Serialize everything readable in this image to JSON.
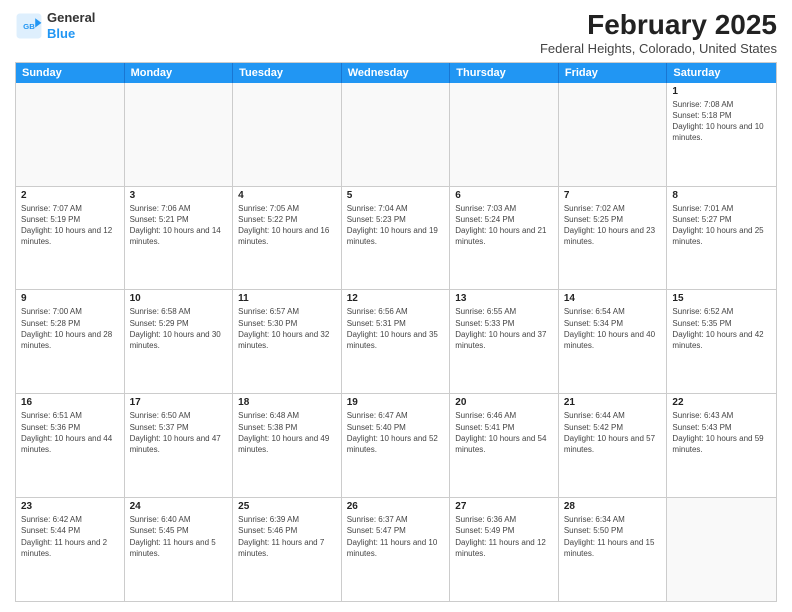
{
  "logo": {
    "text_general": "General",
    "text_blue": "Blue"
  },
  "header": {
    "title": "February 2025",
    "subtitle": "Federal Heights, Colorado, United States"
  },
  "calendar": {
    "days_of_week": [
      "Sunday",
      "Monday",
      "Tuesday",
      "Wednesday",
      "Thursday",
      "Friday",
      "Saturday"
    ],
    "weeks": [
      [
        {
          "day": "",
          "info": ""
        },
        {
          "day": "",
          "info": ""
        },
        {
          "day": "",
          "info": ""
        },
        {
          "day": "",
          "info": ""
        },
        {
          "day": "",
          "info": ""
        },
        {
          "day": "",
          "info": ""
        },
        {
          "day": "1",
          "info": "Sunrise: 7:08 AM\nSunset: 5:18 PM\nDaylight: 10 hours and 10 minutes."
        }
      ],
      [
        {
          "day": "2",
          "info": "Sunrise: 7:07 AM\nSunset: 5:19 PM\nDaylight: 10 hours and 12 minutes."
        },
        {
          "day": "3",
          "info": "Sunrise: 7:06 AM\nSunset: 5:21 PM\nDaylight: 10 hours and 14 minutes."
        },
        {
          "day": "4",
          "info": "Sunrise: 7:05 AM\nSunset: 5:22 PM\nDaylight: 10 hours and 16 minutes."
        },
        {
          "day": "5",
          "info": "Sunrise: 7:04 AM\nSunset: 5:23 PM\nDaylight: 10 hours and 19 minutes."
        },
        {
          "day": "6",
          "info": "Sunrise: 7:03 AM\nSunset: 5:24 PM\nDaylight: 10 hours and 21 minutes."
        },
        {
          "day": "7",
          "info": "Sunrise: 7:02 AM\nSunset: 5:25 PM\nDaylight: 10 hours and 23 minutes."
        },
        {
          "day": "8",
          "info": "Sunrise: 7:01 AM\nSunset: 5:27 PM\nDaylight: 10 hours and 25 minutes."
        }
      ],
      [
        {
          "day": "9",
          "info": "Sunrise: 7:00 AM\nSunset: 5:28 PM\nDaylight: 10 hours and 28 minutes."
        },
        {
          "day": "10",
          "info": "Sunrise: 6:58 AM\nSunset: 5:29 PM\nDaylight: 10 hours and 30 minutes."
        },
        {
          "day": "11",
          "info": "Sunrise: 6:57 AM\nSunset: 5:30 PM\nDaylight: 10 hours and 32 minutes."
        },
        {
          "day": "12",
          "info": "Sunrise: 6:56 AM\nSunset: 5:31 PM\nDaylight: 10 hours and 35 minutes."
        },
        {
          "day": "13",
          "info": "Sunrise: 6:55 AM\nSunset: 5:33 PM\nDaylight: 10 hours and 37 minutes."
        },
        {
          "day": "14",
          "info": "Sunrise: 6:54 AM\nSunset: 5:34 PM\nDaylight: 10 hours and 40 minutes."
        },
        {
          "day": "15",
          "info": "Sunrise: 6:52 AM\nSunset: 5:35 PM\nDaylight: 10 hours and 42 minutes."
        }
      ],
      [
        {
          "day": "16",
          "info": "Sunrise: 6:51 AM\nSunset: 5:36 PM\nDaylight: 10 hours and 44 minutes."
        },
        {
          "day": "17",
          "info": "Sunrise: 6:50 AM\nSunset: 5:37 PM\nDaylight: 10 hours and 47 minutes."
        },
        {
          "day": "18",
          "info": "Sunrise: 6:48 AM\nSunset: 5:38 PM\nDaylight: 10 hours and 49 minutes."
        },
        {
          "day": "19",
          "info": "Sunrise: 6:47 AM\nSunset: 5:40 PM\nDaylight: 10 hours and 52 minutes."
        },
        {
          "day": "20",
          "info": "Sunrise: 6:46 AM\nSunset: 5:41 PM\nDaylight: 10 hours and 54 minutes."
        },
        {
          "day": "21",
          "info": "Sunrise: 6:44 AM\nSunset: 5:42 PM\nDaylight: 10 hours and 57 minutes."
        },
        {
          "day": "22",
          "info": "Sunrise: 6:43 AM\nSunset: 5:43 PM\nDaylight: 10 hours and 59 minutes."
        }
      ],
      [
        {
          "day": "23",
          "info": "Sunrise: 6:42 AM\nSunset: 5:44 PM\nDaylight: 11 hours and 2 minutes."
        },
        {
          "day": "24",
          "info": "Sunrise: 6:40 AM\nSunset: 5:45 PM\nDaylight: 11 hours and 5 minutes."
        },
        {
          "day": "25",
          "info": "Sunrise: 6:39 AM\nSunset: 5:46 PM\nDaylight: 11 hours and 7 minutes."
        },
        {
          "day": "26",
          "info": "Sunrise: 6:37 AM\nSunset: 5:47 PM\nDaylight: 11 hours and 10 minutes."
        },
        {
          "day": "27",
          "info": "Sunrise: 6:36 AM\nSunset: 5:49 PM\nDaylight: 11 hours and 12 minutes."
        },
        {
          "day": "28",
          "info": "Sunrise: 6:34 AM\nSunset: 5:50 PM\nDaylight: 11 hours and 15 minutes."
        },
        {
          "day": "",
          "info": ""
        }
      ]
    ]
  }
}
